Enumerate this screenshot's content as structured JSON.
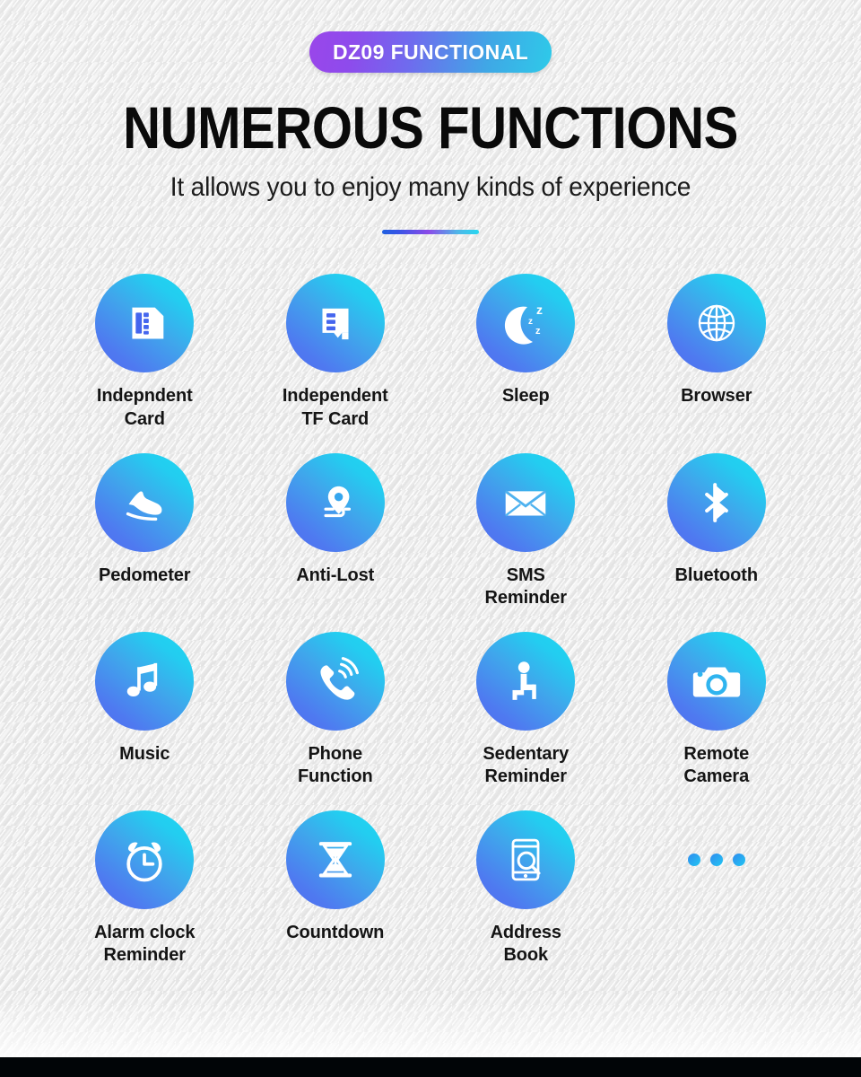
{
  "badge": {
    "label": "DZ09 FUNCTIONAL"
  },
  "header": {
    "title": "NUMEROUS FUNCTIONS",
    "subtitle": "It allows you to enjoy many kinds of experience"
  },
  "colors": {
    "badge_start": "#9a46ea",
    "badge_end": "#2ecae9",
    "circle_start": "#4f6df0",
    "circle_end": "#1fd8f2",
    "divider_start": "#1f5fe0",
    "divider_mid": "#8b4ae8",
    "divider_end": "#27d7f0",
    "background": "#e8e8e8",
    "text": "#141414",
    "bottom_bar": "#010507"
  },
  "features": [
    {
      "icon": "sim-card-icon",
      "label": "Indepndent\nCard"
    },
    {
      "icon": "tf-card-icon",
      "label": "Independent\nTF Card"
    },
    {
      "icon": "sleep-moon-icon",
      "label": "Sleep"
    },
    {
      "icon": "globe-browser-icon",
      "label": "Browser"
    },
    {
      "icon": "shoe-pedometer-icon",
      "label": "Pedometer"
    },
    {
      "icon": "location-pin-icon",
      "label": "Anti-Lost"
    },
    {
      "icon": "envelope-icon",
      "label": "SMS\nReminder"
    },
    {
      "icon": "bluetooth-icon",
      "label": "Bluetooth"
    },
    {
      "icon": "music-note-icon",
      "label": "Music"
    },
    {
      "icon": "phone-handset-icon",
      "label": "Phone\nFunction"
    },
    {
      "icon": "seated-person-icon",
      "label": "Sedentary\nReminder"
    },
    {
      "icon": "camera-icon",
      "label": "Remote\nCamera"
    },
    {
      "icon": "alarm-clock-icon",
      "label": "Alarm clock\nReminder"
    },
    {
      "icon": "hourglass-icon",
      "label": "Countdown"
    },
    {
      "icon": "phone-search-icon",
      "label": "Address\nBook"
    },
    {
      "icon": "more-dots-icon",
      "label": ""
    }
  ]
}
